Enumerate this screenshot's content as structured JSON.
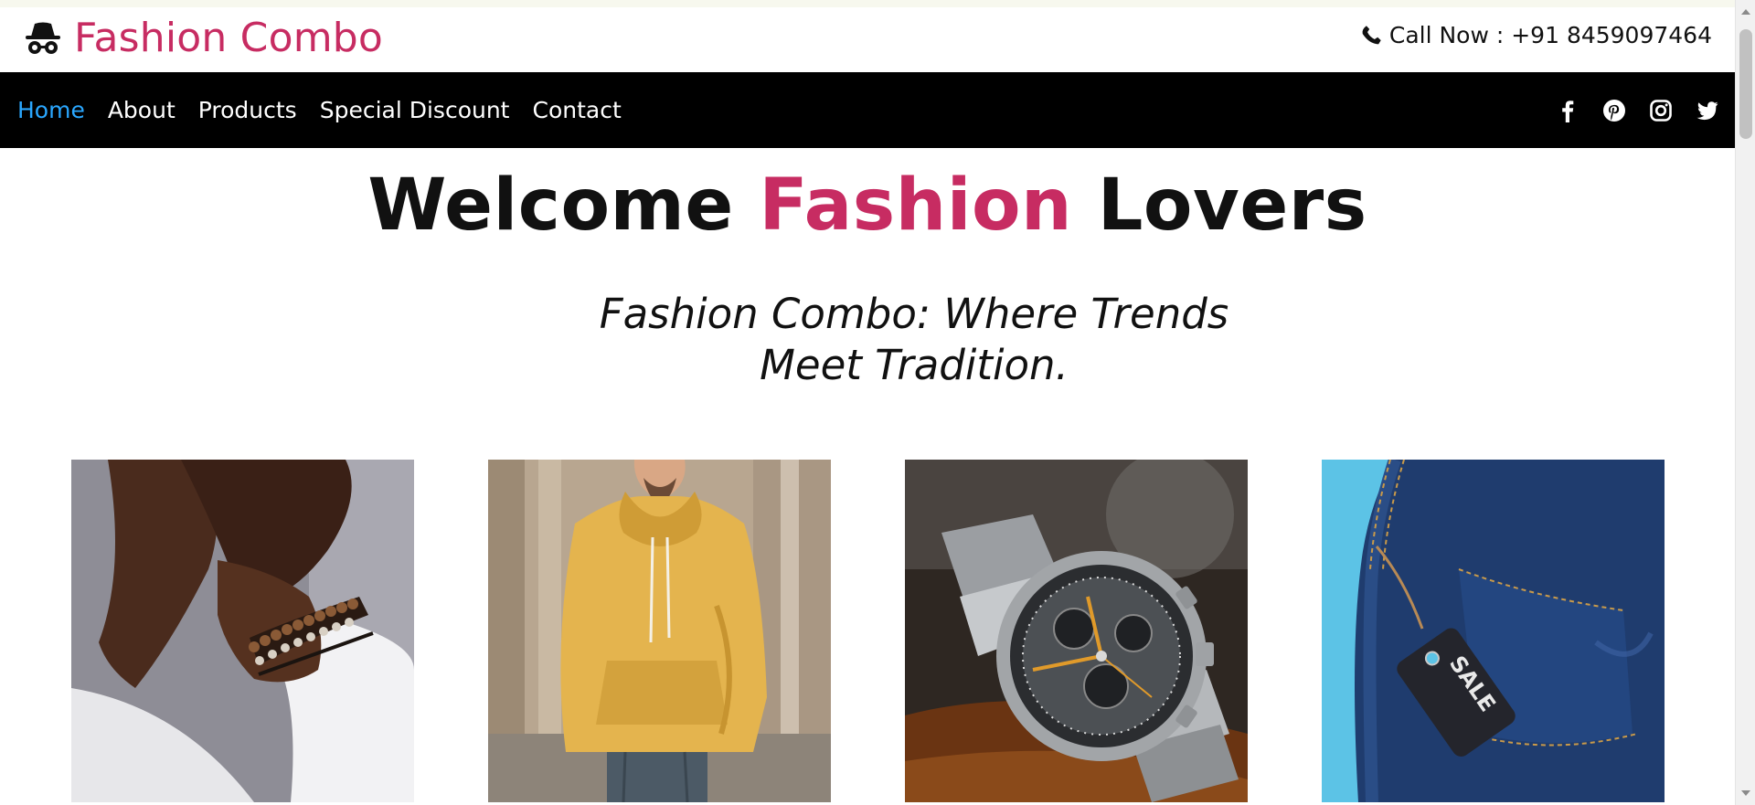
{
  "header": {
    "brand": "Fashion Combo",
    "brand_icon": "incognito-icon",
    "phone_icon": "phone-icon",
    "call_now": "Call Now : +91 8459097464"
  },
  "nav": {
    "links": [
      "Home",
      "About",
      "Products",
      "Special Discount",
      "Contact"
    ],
    "active": "Home",
    "socials": [
      "facebook-icon",
      "pinterest-icon",
      "instagram-icon",
      "twitter-icon"
    ]
  },
  "hero": {
    "title_part1": "Welcome ",
    "title_accent": "Fashion",
    "title_part2": " Lovers",
    "tagline": "Fashion Combo: Where Trends Meet Tradition."
  },
  "products": [
    {
      "image": "bracelet-wrist-photo"
    },
    {
      "image": "yellow-hoodie-photo"
    },
    {
      "image": "chronograph-watch-photo"
    },
    {
      "image": "jeans-sale-tag-photo"
    }
  ],
  "colors": {
    "accent": "#c72c62",
    "nav_bg": "#000000",
    "nav_active": "#2aa7ff",
    "text": "#111111"
  }
}
